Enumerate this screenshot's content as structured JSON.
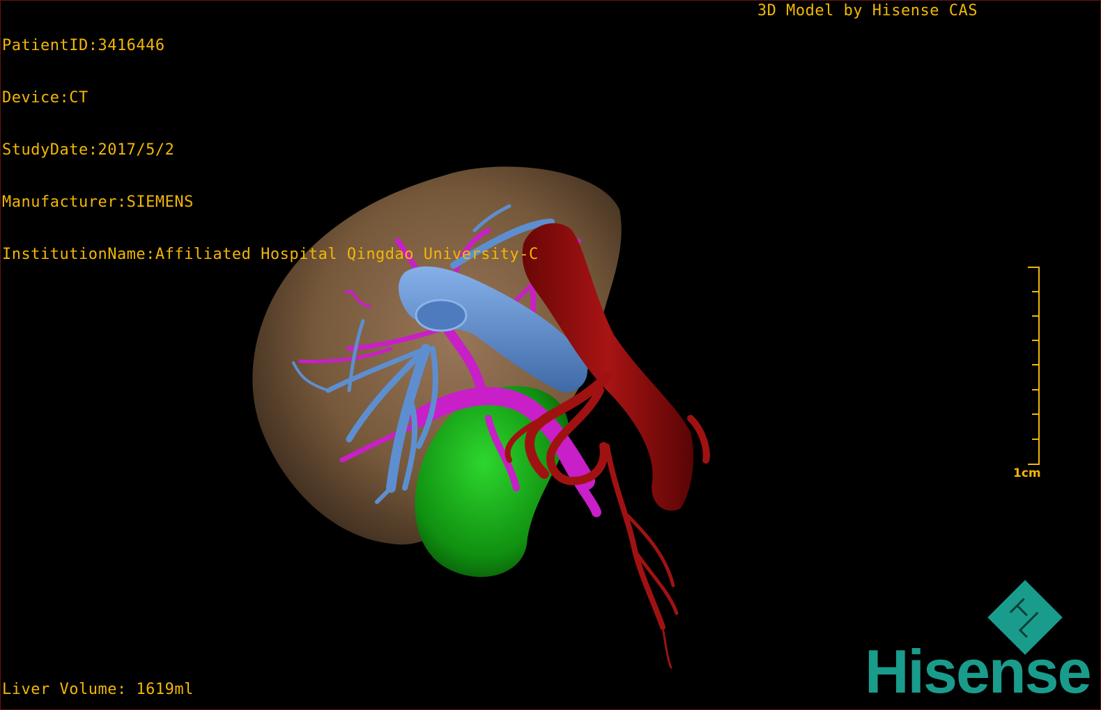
{
  "study_info": {
    "patient_id": "PatientID:3416446",
    "device": "Device:CT",
    "study_date": "StudyDate:2017/5/2",
    "manufacturer": "Manufacturer:SIEMENS",
    "institution": "InstitutionName:Affiliated Hospital Qingdao University-C"
  },
  "model_credit": "3D Model by Hisense CAS",
  "liver_volume": "Liver Volume: 1619ml",
  "scale_bar": {
    "label": "1cm",
    "color": "#f2b705"
  },
  "brand": {
    "name": "Hisense",
    "logo_icon": "hisense-diamond-logo",
    "color": "#1a9c8c"
  },
  "model_structures": [
    {
      "name": "liver",
      "color": "#8a6a45"
    },
    {
      "name": "portal-vein",
      "color": "#c81fc8"
    },
    {
      "name": "hepatic-vein",
      "color": "#5d8fd0"
    },
    {
      "name": "inferior-vena-cava-aorta",
      "color": "#8f0c0c"
    },
    {
      "name": "gallbladder-stomach",
      "color": "#12a012"
    }
  ]
}
